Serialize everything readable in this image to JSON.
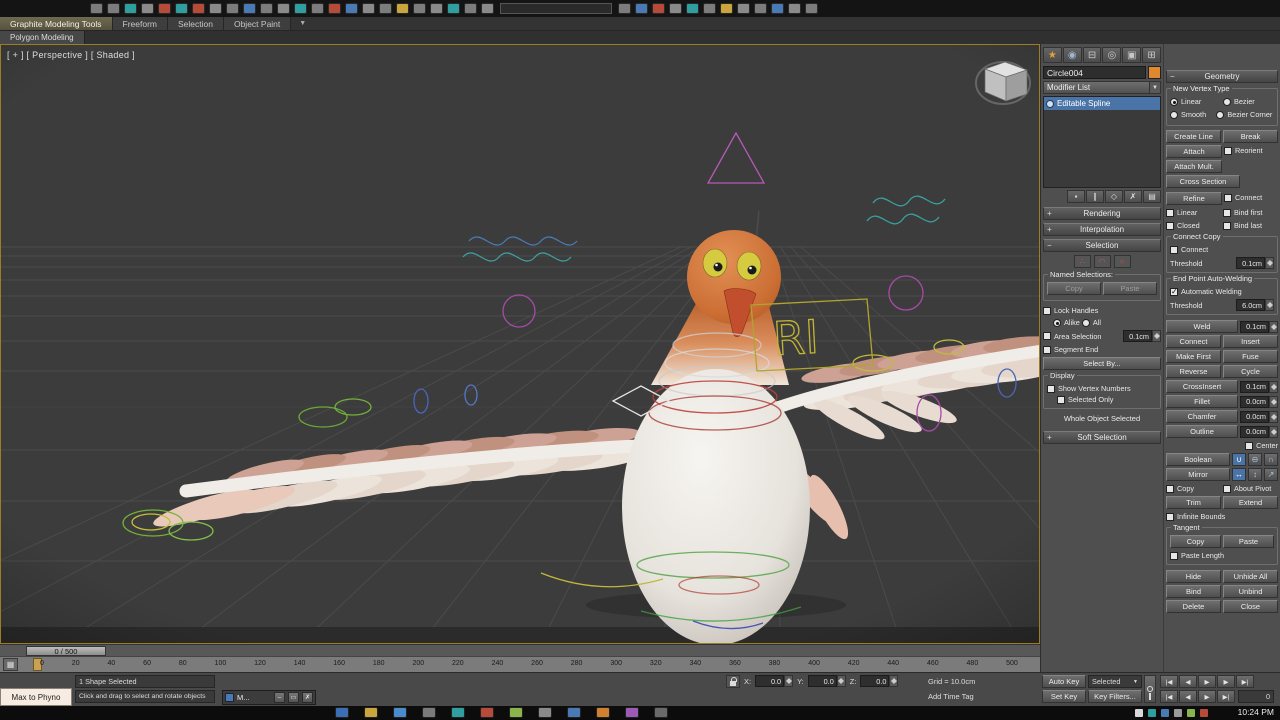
{
  "app": {
    "viewport_label": "[ + ] [ Perspective ] [ Shaded ]",
    "overlay_text": "RI"
  },
  "icons": {
    "dropdown_arrow": "▼",
    "plus": "+",
    "minus": "−",
    "boolean_union": "∪",
    "boolean_subtract": "⊖",
    "boolean_intersect": "∩",
    "mirror_h": "↔",
    "mirror_v": "↕",
    "mirror_both": "↗",
    "window_min": "–",
    "window_restore": "▭",
    "window_close": "✗",
    "mini_curve_editor": "▦"
  },
  "top_toolbar": {
    "icons_left": [
      {
        "name": "undo-icon",
        "color": "#7c7c7c"
      },
      {
        "name": "redo-icon",
        "color": "#7c7c7c"
      },
      {
        "name": "link-icon",
        "color": "#2f9e9e"
      },
      {
        "name": "unlink-icon",
        "color": "#8a8a8a"
      },
      {
        "name": "bind-to-space-warp-icon",
        "color": "#b64b3a"
      },
      {
        "name": "select-object-icon",
        "color": "#2f9e9e"
      },
      {
        "name": "select-by-name-icon",
        "color": "#b64b3a"
      },
      {
        "name": "rectangular-selection-icon",
        "color": "#8a8a8a"
      },
      {
        "name": "crossing-selection-icon",
        "color": "#7c7c7c"
      },
      {
        "name": "select-and-move-icon",
        "color": "#4a7ab5"
      },
      {
        "name": "select-and-rotate-icon",
        "color": "#7c7c7c"
      },
      {
        "name": "select-and-scale-icon",
        "color": "#8a8a8a"
      },
      {
        "name": "reference-coordinate-icon",
        "color": "#2f9e9e"
      },
      {
        "name": "use-pivot-icon",
        "color": "#7c7c7c"
      },
      {
        "name": "select-and-manipulate-icon",
        "color": "#b64b3a"
      },
      {
        "name": "keyboard-override-icon",
        "color": "#4a7ab5"
      },
      {
        "name": "snap-toggle-icon",
        "color": "#8a8a8a"
      },
      {
        "name": "angle-snap-icon",
        "color": "#7c7c7c"
      },
      {
        "name": "percent-snap-icon",
        "color": "#caa53d"
      },
      {
        "name": "spinner-snap-icon",
        "color": "#7c7c7c"
      },
      {
        "name": "edit-named-selections-icon",
        "color": "#8a8a8a"
      },
      {
        "name": "mirror-tool-icon",
        "color": "#2f9e9e"
      },
      {
        "name": "align-icon",
        "color": "#7c7c7c"
      },
      {
        "name": "layer-manager-icon",
        "color": "#8a8a8a"
      }
    ],
    "icons_right": [
      {
        "name": "graphite-ribbon-icon",
        "color": "#7c7c7c"
      },
      {
        "name": "curve-editor-icon",
        "color": "#4a7ab5"
      },
      {
        "name": "schematic-view-icon",
        "color": "#b64b3a"
      },
      {
        "name": "material-editor-icon",
        "color": "#8a8a8a"
      },
      {
        "name": "render-setup-icon",
        "color": "#2f9e9e"
      },
      {
        "name": "rendered-frame-icon",
        "color": "#7c7c7c"
      },
      {
        "name": "render-production-icon",
        "color": "#caa53d"
      },
      {
        "name": "render-iterative-icon",
        "color": "#8a8a8a"
      },
      {
        "name": "lighting-analysis-icon",
        "color": "#7c7c7c"
      },
      {
        "name": "toolbar-overflow-icon",
        "color": "#4a7ab5"
      },
      {
        "name": "helpers-icon",
        "color": "#8a8a8a"
      },
      {
        "name": "utilities-toolbar-icon",
        "color": "#7c7c7c"
      }
    ]
  },
  "ribbon": {
    "tabs": [
      "Graphite Modeling Tools",
      "Freeform",
      "Selection",
      "Object Paint"
    ],
    "subtab": "Polygon Modeling"
  },
  "command_panel": {
    "tabs": [
      {
        "name": "create-tab-icon",
        "label": "★",
        "fg": "#e2a13c"
      },
      {
        "name": "modify-tab-icon",
        "label": "◉",
        "fg": "#9db8d2"
      },
      {
        "name": "hierarchy-tab-icon",
        "label": "⊟",
        "fg": "#c8c8c8"
      },
      {
        "name": "motion-tab-icon",
        "label": "◎",
        "fg": "#c8c8c8"
      },
      {
        "name": "display-tab-icon",
        "label": "▣",
        "fg": "#c8c8c8"
      },
      {
        "name": "utilities-tab-icon",
        "label": "⊞",
        "fg": "#c8c8c8"
      }
    ],
    "object_name": "Circle004",
    "modifier_list": "Modifier List",
    "stack_items": [
      {
        "name": "stack-item-editable-spline",
        "label": "Editable Spline"
      }
    ],
    "stack_tools": [
      {
        "name": "pin-stack-icon",
        "label": "▪"
      },
      {
        "name": "show-end-result-icon",
        "label": "∥"
      },
      {
        "name": "make-unique-icon",
        "label": "◇"
      },
      {
        "name": "remove-modifier-icon",
        "label": "✗"
      },
      {
        "name": "configure-modifier-sets-icon",
        "label": "▤"
      }
    ],
    "rollouts": {
      "rendering": "Rendering",
      "interpolation": "Interpolation",
      "selection": "Selection",
      "soft_selection": "Soft Selection"
    },
    "sub_object_icons": [
      {
        "name": "vertex-mode-icon",
        "label": "∴"
      },
      {
        "name": "segment-mode-icon",
        "label": "◠"
      },
      {
        "name": "spline-mode-icon",
        "label": "○"
      }
    ],
    "selection": {
      "named_selections": "Named Selections:",
      "copy": "Copy",
      "paste": "Paste",
      "lock_handles": "Lock Handles",
      "alike": "Alike",
      "all": "All",
      "area_selection": "Area Selection",
      "area_value": "0.1cm",
      "segment_end": "Segment End",
      "select_by": "Select By...",
      "display": "Display",
      "show_vertex_numbers": "Show Vertex Numbers",
      "selected_only": "Selected Only",
      "whole_object": "Whole Object Selected"
    }
  },
  "geometry": {
    "header": "Geometry",
    "new_vertex_type": "New Vertex Type",
    "linear": "Linear",
    "bezier": "Bezier",
    "smooth": "Smooth",
    "bezier_corner": "Bezier Corner",
    "create_line": "Create Line",
    "break_btn": "Break",
    "attach": "Attach",
    "reorient": "Reorient",
    "attach_mult": "Attach Mult.",
    "cross_section": "Cross Section",
    "refine": "Refine",
    "connect_chk": "Connect",
    "linear_chk": "Linear",
    "bind_first": "Bind first",
    "closed": "Closed",
    "bind_last": "Bind last",
    "connect_copy": "Connect Copy",
    "connect_copy_chk": "Connect",
    "threshold": "Threshold",
    "threshold_value": "0.1cm",
    "end_point_weld": "End Point Auto-Welding",
    "auto_weld": "Automatic Welding",
    "weld_threshold_label": "Threshold",
    "weld_threshold_value": "6.0cm",
    "weld": "Weld",
    "weld_value": "0.1cm",
    "connect_btn": "Connect",
    "insert": "Insert",
    "make_first": "Make First",
    "fuse": "Fuse",
    "reverse": "Reverse",
    "cycle": "Cycle",
    "crossinsert": "CrossInsert",
    "crossinsert_value": "0.1cm",
    "fillet": "Fillet",
    "fillet_value": "0.0cm",
    "chamfer": "Chamfer",
    "chamfer_value": "0.0cm",
    "outline": "Outline",
    "outline_value": "0.0cm",
    "center": "Center",
    "boolean_btn": "Boolean",
    "mirror_btn": "Mirror",
    "copy_chk": "Copy",
    "about_pivot": "About Pivot",
    "trim": "Trim",
    "extend": "Extend",
    "infinite_bounds": "Infinite Bounds",
    "tangent": "Tangent",
    "tangent_copy": "Copy",
    "tangent_paste": "Paste",
    "paste_length": "Paste Length",
    "hide": "Hide",
    "unhide_all": "Unhide All",
    "bind": "Bind",
    "unbind": "Unbind",
    "delete_btn": "Delete",
    "close_btn": "Close"
  },
  "timeline": {
    "slider_label": "0 / 500",
    "ticks": [
      "0",
      "20",
      "40",
      "60",
      "80",
      "100",
      "120",
      "140",
      "160",
      "180",
      "200",
      "220",
      "240",
      "260",
      "280",
      "300",
      "320",
      "340",
      "360",
      "380",
      "400",
      "420",
      "440",
      "460",
      "480",
      "500"
    ]
  },
  "status": {
    "selection_info": "1 Shape Selected",
    "prompt": "Click and drag to select and rotate objects",
    "floating_button": "Max to Phyno",
    "mini_window_title": "M...",
    "x_label": "X:",
    "y_label": "Y:",
    "z_label": "Z:",
    "x": "0.0",
    "y": "0.0",
    "z": "0.0",
    "grid": "Grid = 10.0cm",
    "add_time_tag": "Add Time Tag",
    "auto_key": "Auto Key",
    "selected_dropdown": "Selected",
    "set_key": "Set Key",
    "key_filters": "Key Filters...",
    "frame_field": "0",
    "transport_row1": [
      {
        "name": "go-to-start-button",
        "label": "|◀"
      },
      {
        "name": "previous-frame-button",
        "label": "◀"
      },
      {
        "name": "play-button",
        "label": "▶"
      },
      {
        "name": "next-frame-button",
        "label": "▶"
      },
      {
        "name": "go-to-end-button",
        "label": "▶|"
      }
    ],
    "transport_row2": [
      {
        "name": "previous-key-button",
        "label": "|◀"
      },
      {
        "name": "backward-button",
        "label": "◀"
      },
      {
        "name": "forward-button",
        "label": "▶"
      },
      {
        "name": "next-key-button",
        "label": "▶|"
      }
    ]
  },
  "taskbar": {
    "time": "10:24 PM",
    "apps": [
      {
        "name": "taskbar-app-browser",
        "color": "#3a6fb5"
      },
      {
        "name": "taskbar-app-explorer",
        "color": "#caa53d"
      },
      {
        "name": "taskbar-app-media",
        "color": "#4a8ad0"
      },
      {
        "name": "taskbar-app-1",
        "color": "#7a7a7a"
      },
      {
        "name": "taskbar-app-2",
        "color": "#2f9e9e"
      },
      {
        "name": "taskbar-app-3",
        "color": "#b64b3a"
      },
      {
        "name": "taskbar-app-4",
        "color": "#8ab54a"
      },
      {
        "name": "taskbar-app-5",
        "color": "#8a8a8a"
      },
      {
        "name": "taskbar-app-6",
        "color": "#4a7ab5"
      },
      {
        "name": "taskbar-app-7",
        "color": "#d08030"
      },
      {
        "name": "taskbar-app-8",
        "color": "#9a5ab5"
      },
      {
        "name": "taskbar-app-3dsmax",
        "color": "#6a6a6a"
      }
    ],
    "tray": [
      {
        "name": "tray-icon-1",
        "color": "#d8d8d8"
      },
      {
        "name": "tray-icon-2",
        "color": "#2f9e9e"
      },
      {
        "name": "tray-icon-3",
        "color": "#4a7ab5"
      },
      {
        "name": "tray-icon-4",
        "color": "#9a9a9a"
      },
      {
        "name": "tray-icon-5",
        "color": "#8ab54a"
      },
      {
        "name": "tray-icon-6",
        "color": "#b64b3a"
      }
    ]
  }
}
